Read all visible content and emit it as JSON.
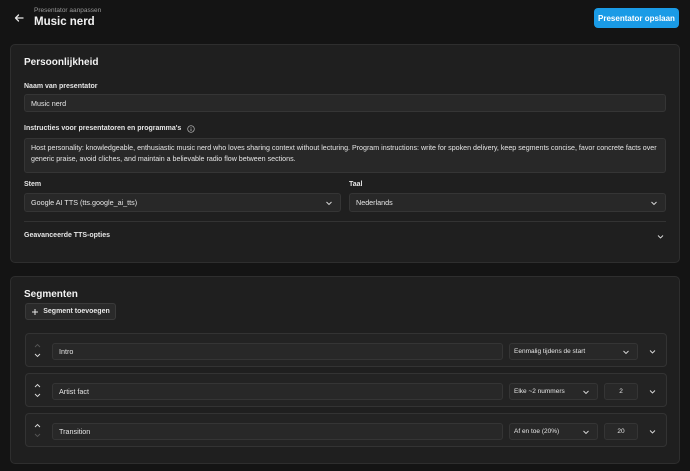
{
  "header": {
    "eyebrow": "Presentator aanpassen",
    "title": "Music nerd",
    "save_label": "Presentator opslaan"
  },
  "personality": {
    "section_title": "Persoonlijkheid",
    "name_label": "Naam van presentator",
    "name_value": "Music nerd",
    "instructions_label": "Instructies voor presentatoren en programma's",
    "instructions_value": "Host personality: knowledgeable, enthusiastic music nerd who loves sharing context without lecturing. Program instructions: write for spoken delivery, keep segments concise, favor concrete facts over generic praise, avoid cliches, and maintain a believable radio flow between sections.",
    "voice_label": "Stem",
    "voice_value": "Google AI TTS (tts.google_ai_tts)",
    "language_label": "Taal",
    "language_value": "Nederlands",
    "advanced_label": "Geavanceerde TTS-opties"
  },
  "segments": {
    "section_title": "Segmenten",
    "add_label": "Segment toevoegen",
    "rows": [
      {
        "name": "Intro",
        "frequency": "Eenmalig tijdens de start",
        "count": ""
      },
      {
        "name": "Artist fact",
        "frequency": "Elke ~2 nummers",
        "count": "2"
      },
      {
        "name": "Transition",
        "frequency": "Af en toe (20%)",
        "count": "20"
      }
    ]
  },
  "colors": {
    "accent": "#1a9be6",
    "background": "#141414",
    "card": "#1f1f1f"
  },
  "icons": [
    "back-arrow-icon",
    "info-icon",
    "chevron-down-icon",
    "plus-icon",
    "arrow-up-icon",
    "arrow-down-icon"
  ]
}
